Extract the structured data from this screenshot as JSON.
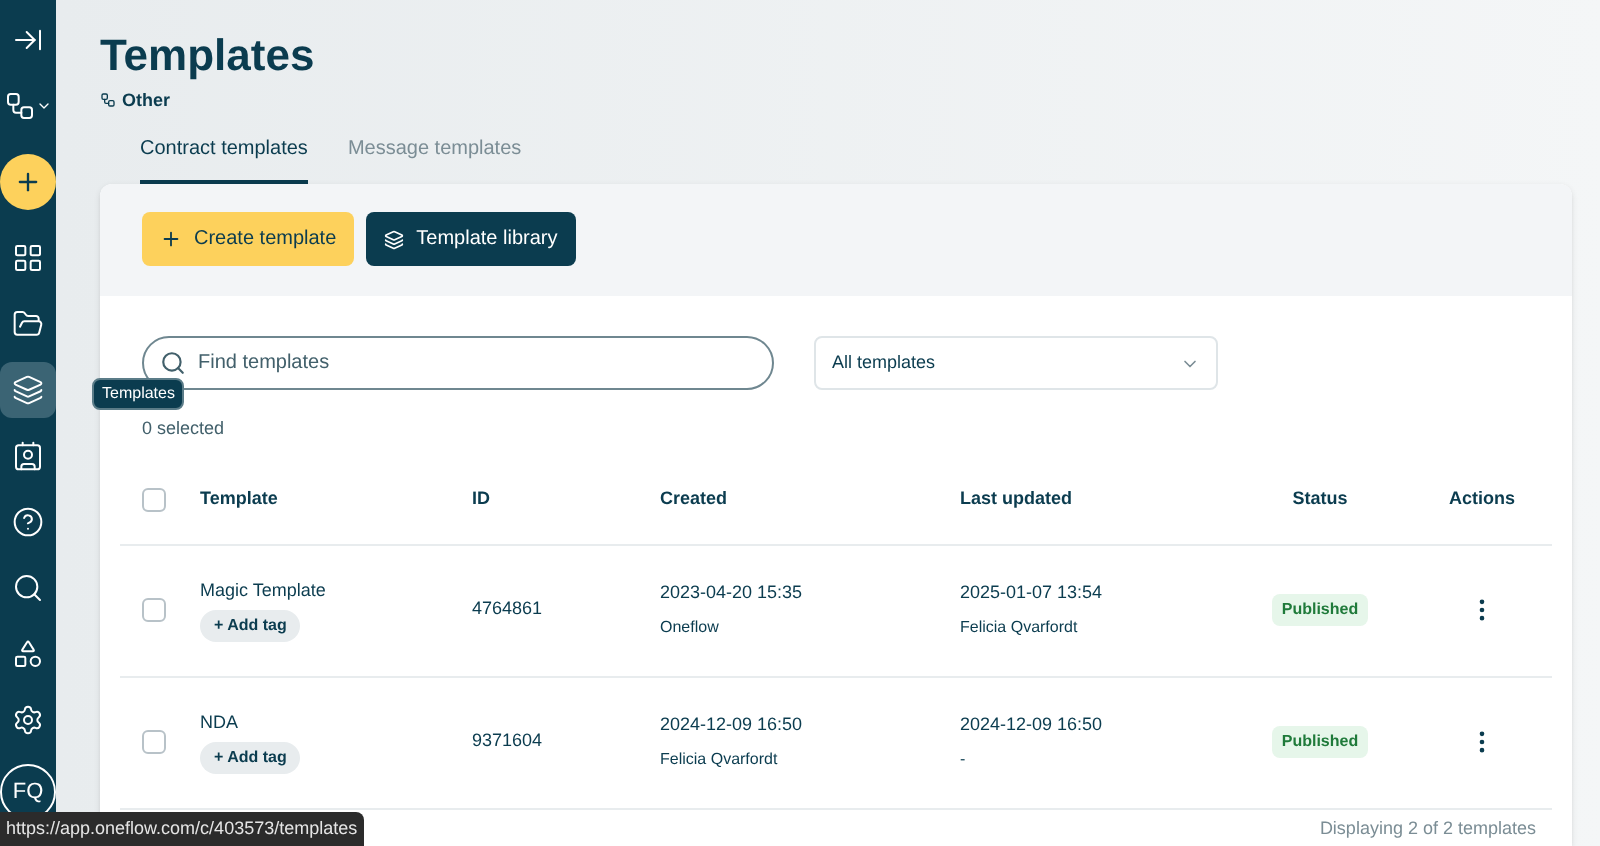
{
  "sidebar": {
    "items": [
      {
        "kind": "menu",
        "selected": false
      },
      {
        "kind": "workspace",
        "selected": false
      },
      {
        "kind": "create",
        "selected": false
      },
      {
        "kind": "dashboard",
        "selected": false
      },
      {
        "kind": "folder",
        "selected": false
      },
      {
        "kind": "templates",
        "selected": true
      },
      {
        "kind": "contacts",
        "selected": false
      },
      {
        "kind": "help",
        "selected": false
      },
      {
        "kind": "search",
        "selected": false
      },
      {
        "kind": "extensions",
        "selected": false
      },
      {
        "kind": "settings",
        "selected": false
      }
    ],
    "avatar": "FQ",
    "tooltip": "Templates"
  },
  "page": {
    "title": "Templates",
    "workspace": "Other"
  },
  "tabs": [
    {
      "label": "Contract templates",
      "selected": true
    },
    {
      "label": "Message templates",
      "selected": false
    }
  ],
  "buttons": [
    {
      "kind": "create",
      "label": "Create template"
    },
    {
      "kind": "library",
      "label": "Template library"
    }
  ],
  "search": {
    "placeholder": "Find templates"
  },
  "filter": {
    "value": "All templates"
  },
  "selected_count": "0 selected",
  "table": {
    "select_all": {
      "checked": false
    },
    "columns": [
      "Template",
      "ID",
      "Created",
      "Last updated",
      "Status",
      "Actions"
    ],
    "rows": [
      {
        "checked": false,
        "name": "Magic Template",
        "tag": "+ Add tag",
        "id": "4764861",
        "created": "2023-04-20 15:35",
        "created_by": "Oneflow",
        "updated": "2025-01-07 13:54",
        "updated_by": "Felicia Qvarfordt",
        "status": "Published"
      },
      {
        "checked": false,
        "name": "NDA",
        "tag": "+ Add tag",
        "id": "9371604",
        "created": "2024-12-09 16:50",
        "created_by": "Felicia Qvarfordt",
        "updated": "2024-12-09 16:50",
        "updated_by": "-",
        "status": "Published"
      }
    ]
  },
  "footer": "Displaying 2 of 2 templates",
  "status_bar": {
    "url": "https://app.oneflow.com/c/403573/templates"
  }
}
